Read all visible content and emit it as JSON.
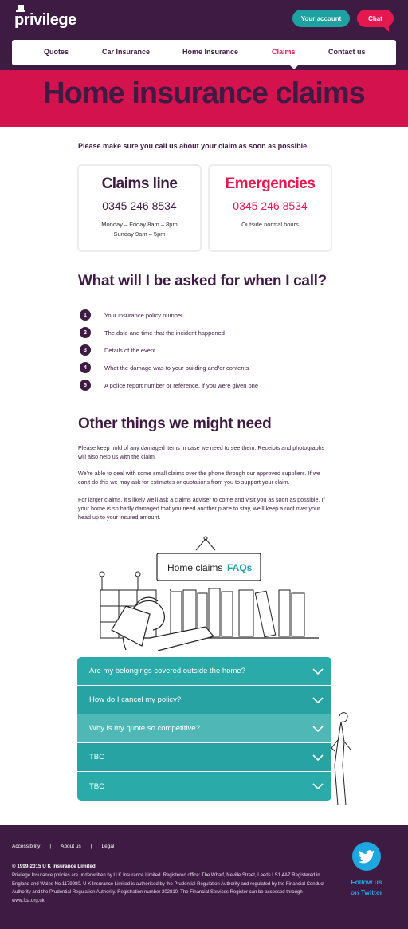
{
  "header": {
    "logo": "privilege",
    "account_button": "Your account",
    "chat_button": "Chat"
  },
  "nav": {
    "items": [
      "Quotes",
      "Car Insurance",
      "Home Insurance",
      "Claims",
      "Contact us"
    ],
    "active": "Claims"
  },
  "hero": {
    "title": "Home insurance claims"
  },
  "intro": "Please make sure you call us about your claim as soon as possible.",
  "cards": {
    "claims": {
      "title": "Claims line",
      "phone": "0345 246 8534",
      "hours1": "Monday – Friday 8am – 8pm",
      "hours2": "Sunday 9am – 5pm"
    },
    "emergencies": {
      "title": "Emergencies",
      "phone": "0345 246 8534",
      "hours1": "Outside normal hours"
    }
  },
  "asked": {
    "heading": "What will I be asked for when I call?",
    "steps": [
      {
        "num": "1",
        "text": "Your insurance policy number"
      },
      {
        "num": "2",
        "text": "The date and time that the incident happened"
      },
      {
        "num": "3",
        "text": "Details of the event"
      },
      {
        "num": "4",
        "text": "What the damage was to your building and/or contents"
      },
      {
        "num": "5",
        "text": "A police report number or reference, if you were given one"
      }
    ]
  },
  "other": {
    "heading": "Other things we might need",
    "p1": "Please keep hold of any damaged items in case we need to see them. Receipts and photographs will also help us with the claim.",
    "p2": "We’re able to deal with some small claims over the phone through our approved suppliers. If we can’t do this we may ask for estimates or quotations from you to support your claim.",
    "p3": "For larger claims, it’s likely we’ll ask a claims adviser to come and visit you as soon as possible. If your home is so badly damaged that you need another place to stay, we’ll keep a roof over your head up to your insured amount."
  },
  "faq_sign": {
    "text": "Home claims",
    "accent": "FAQs"
  },
  "faqs": [
    "Are my belongings covered outside the home?",
    "How do I cancel my policy?",
    "Why is my quote so competitive?",
    "TBC",
    "TBC"
  ],
  "footer": {
    "links": [
      "Accessibility",
      "About us",
      "Legal"
    ],
    "copyright": "© 1999-2015 U K Insurance Limited",
    "legal": "Privilege Insurance policies are underwritten by U K Insurance Limited. Registered office: The Wharf, Neville Street, Leeds LS1 4AZ Registered in England and Wales No.1179980. U K Insurance Limited is authorised by the Prudential Regulation Authority and regulated by the Financial Conduct Authority and the Prudential Regulation Authority. Registration number 202810. The Financial Services Register can be accessed through www.fca.org.uk",
    "twitter_line1": "Follow us",
    "twitter_line2": "on Twitter"
  },
  "colors": {
    "purple": "#3e1b43",
    "pink": "#e5174f",
    "teal": "#26a3a2",
    "twitter": "#1da6e0"
  },
  "icons": [
    "top-hat-icon",
    "chevron-down-icon",
    "twitter-bird-icon"
  ]
}
